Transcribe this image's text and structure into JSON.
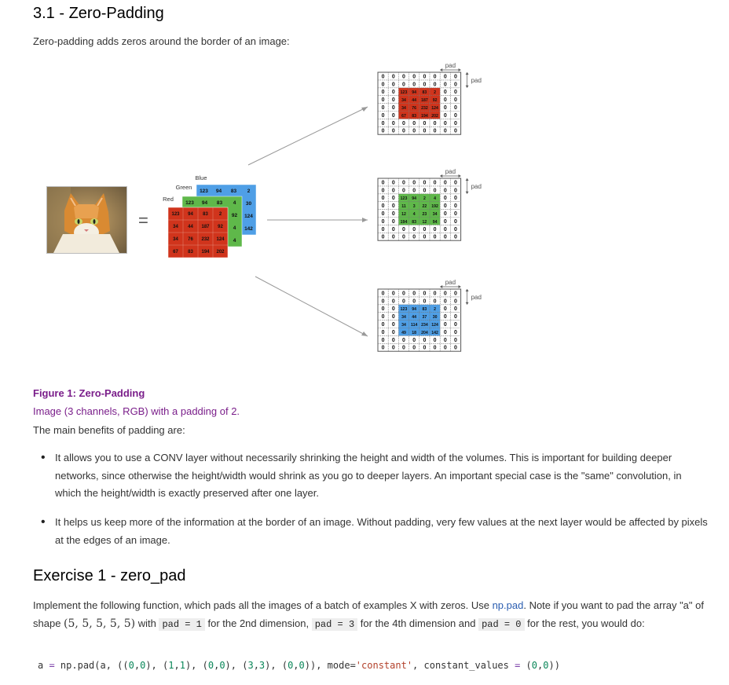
{
  "section_title": "3.1 - Zero-Padding",
  "intro": "Zero-padding adds zeros around the border of an image:",
  "figure": {
    "label_blue": "Blue",
    "label_green": "Green",
    "label_red": "Red",
    "pad_label": "pad",
    "equals": "=",
    "red_channel": [
      [
        "123",
        "94",
        "83",
        "2"
      ],
      [
        "34",
        "44",
        "187",
        "92"
      ],
      [
        "34",
        "76",
        "232",
        "124"
      ],
      [
        "67",
        "83",
        "194",
        "202"
      ]
    ],
    "green_front_row": [
      "123",
      "94",
      "83",
      "4"
    ],
    "green_right_col": [
      "92",
      "4",
      "4"
    ],
    "blue_front_row": [
      "123",
      "94",
      "83",
      "2"
    ],
    "blue_right_col": [
      "30",
      "124",
      "142"
    ],
    "padded_red": [
      [
        "123",
        "94",
        "83",
        "2"
      ],
      [
        "34",
        "44",
        "187",
        "92"
      ],
      [
        "34",
        "76",
        "232",
        "124"
      ],
      [
        "67",
        "83",
        "194",
        "202"
      ]
    ],
    "padded_green": [
      [
        "123",
        "94",
        "2",
        "4"
      ],
      [
        "11",
        "3",
        "22",
        "192"
      ],
      [
        "12",
        "4",
        "23",
        "34"
      ],
      [
        "194",
        "83",
        "12",
        "94"
      ]
    ],
    "padded_blue": [
      [
        "123",
        "94",
        "83",
        "2"
      ],
      [
        "34",
        "44",
        "37",
        "30"
      ],
      [
        "34",
        "114",
        "234",
        "124"
      ],
      [
        "49",
        "18",
        "204",
        "142"
      ]
    ],
    "zero": "0"
  },
  "caption": {
    "figure_label": "Figure 1",
    "figure_title": ": Zero-Padding",
    "subtitle": "Image (3 channels, RGB) with a padding of 2."
  },
  "benefits_intro": "The main benefits of padding are:",
  "bullets": [
    "It allows you to use a CONV layer without necessarily shrinking the height and width of the volumes. This is important for building deeper networks, since otherwise the height/width would shrink as you go to deeper layers. An important special case is the \"same\" convolution, in which the height/width is exactly preserved after one layer.",
    "It helps us keep more of the information at the border of an image. Without padding, very few values at the next layer would be affected by pixels at the edges of an image."
  ],
  "exercise_title": "Exercise 1 - zero_pad",
  "exercise": {
    "p1": "Implement the following function, which pads all the images of a batch of examples X with zeros. Use ",
    "link": "np.pad",
    "p2": ". Note if you want to pad the array \"a\" of shape ",
    "shape": "(5, 5, 5, 5, 5)",
    "p3": " with ",
    "code1": "pad = 1",
    "p4": " for the 2nd dimension, ",
    "code2": "pad = 3",
    "p5": " for the 4th dimension and ",
    "code3": "pad = 0",
    "p6": " for the rest, you would do:"
  },
  "code": {
    "a": "a",
    "eq": " = ",
    "call": "np.pad(a, ((",
    "n1": "0",
    "c1": ",",
    "n2": "0",
    "p1": "), (",
    "n3": "1",
    "c2": ",",
    "n4": "1",
    "p2": "), (",
    "n5": "0",
    "c3": ",",
    "n6": "0",
    "p3": "), (",
    "n7": "3",
    "c4": ",",
    "n8": "3",
    "p4": "), (",
    "n9": "0",
    "c5": ",",
    "n10": "0",
    "p5": ")), mode=",
    "mode": "'constant'",
    "p6": ", constant_values ",
    "eq2": "=",
    "p7": " (",
    "n11": "0",
    "c6": ",",
    "n12": "0",
    "p8": "))"
  },
  "colors": {
    "red": "#d0341c",
    "green": "#5fb84a",
    "blue": "#4f9fe6",
    "caption": "#7a1e8a",
    "link": "#2a5db0"
  }
}
